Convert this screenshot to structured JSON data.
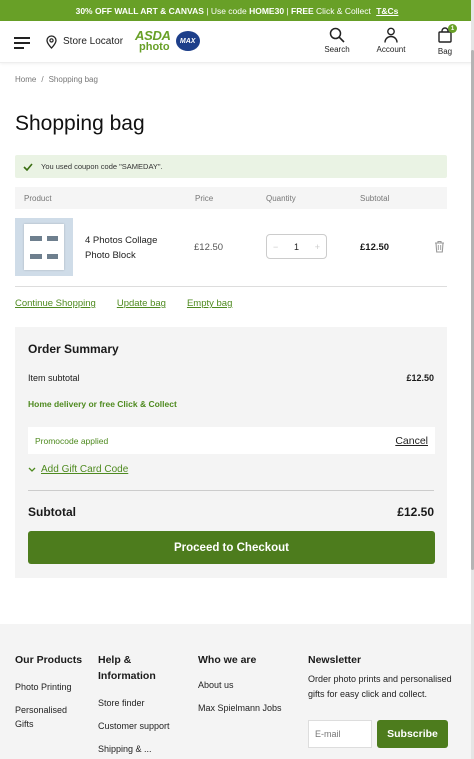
{
  "promo_bar": {
    "part1": "30% OFF WALL ART & CANVAS",
    "part2": " | Use code ",
    "code": "HOME30",
    "part3": " | ",
    "free": "FREE",
    "part4": " Click & Collect ",
    "tc": "T&Cs"
  },
  "header": {
    "store_locator": "Store Locator",
    "logo_asda": "ASDA",
    "logo_photo": "photo",
    "logo_max": "MAX",
    "search": "Search",
    "account": "Account",
    "bag": "Bag",
    "bag_count": "1"
  },
  "breadcrumb": {
    "home": "Home",
    "sep": "/",
    "current": "Shopping bag"
  },
  "page_title": "Shopping bag",
  "notice": "You used coupon code \"SAMEDAY\".",
  "table": {
    "headers": {
      "product": "Product",
      "price": "Price",
      "quantity": "Quantity",
      "subtotal": "Subtotal"
    },
    "row": {
      "name": "4 Photos Collage Photo Block",
      "price": "£12.50",
      "qty_minus": "−",
      "qty": "1",
      "qty_plus": "+",
      "subtotal": "£12.50"
    }
  },
  "links": {
    "continue": "Continue Shopping",
    "update": "Update bag",
    "empty": "Empty bag"
  },
  "summary": {
    "title": "Order Summary",
    "item_subtotal_label": "Item subtotal",
    "item_subtotal": "£12.50",
    "delivery": "Home delivery or free Click & Collect",
    "promo_label": "Promocode applied",
    "cancel": "Cancel",
    "gift": "Add Gift Card Code",
    "subtotal_label": "Subtotal",
    "subtotal": "£12.50",
    "checkout": "Proceed to Checkout"
  },
  "footer": {
    "our_products": "Our Products",
    "products": [
      "Photo Printing",
      "Personalised Gifts"
    ],
    "help": "Help & Information",
    "help_links": [
      "Store finder",
      "Customer support",
      "Shipping & ..."
    ],
    "who": "Who we are",
    "who_links": [
      "About us",
      "Max Spielmann Jobs"
    ],
    "newsletter": "Newsletter",
    "newsletter_text": "Order photo prints and personalised gifts for easy click and collect.",
    "email_placeholder": "E-mail",
    "subscribe": "Subscribe"
  },
  "colors": {
    "brand_green": "#68a027",
    "button_green": "#4d7c1d",
    "notice_bg": "#eaf3e4"
  }
}
